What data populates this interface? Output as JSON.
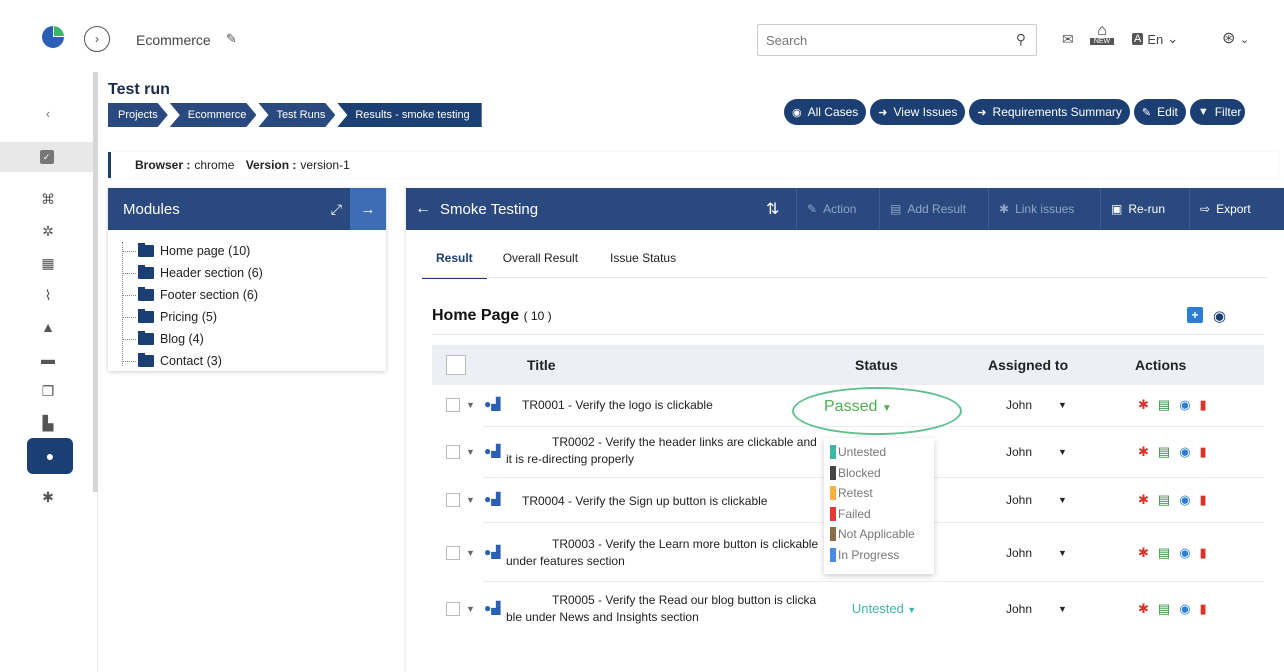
{
  "header": {
    "project_name": "Ecommerce",
    "search_placeholder": "Search",
    "new_badge": "NEW",
    "language": "En",
    "translate_glyph": "A"
  },
  "page": {
    "title": "Test run",
    "breadcrumb": [
      "Projects",
      "Ecommerce",
      "Test Runs",
      "Results - smoke testing"
    ]
  },
  "toolbar": {
    "all_cases": "All Cases",
    "view_issues": "View Issues",
    "requirements_summary": "Requirements Summary",
    "edit": "Edit",
    "filter": "Filter"
  },
  "browser_info": {
    "browser_label": "Browser :",
    "browser_value": "chrome",
    "version_label": "Version :",
    "version_value": "version-1"
  },
  "modules": {
    "title": "Modules",
    "items": [
      {
        "name": "Home page",
        "count": "(10)"
      },
      {
        "name": "Header section",
        "count": "(6)"
      },
      {
        "name": "Footer section",
        "count": "(6)"
      },
      {
        "name": "Pricing",
        "count": "(5)"
      },
      {
        "name": "Blog",
        "count": "(4)"
      },
      {
        "name": "Contact",
        "count": "(3)"
      }
    ]
  },
  "main": {
    "title": "Smoke Testing",
    "buttons": {
      "action": "Action",
      "add_result": "Add Result",
      "link_issues": "Link issues",
      "rerun": "Re-run",
      "export": "Export"
    },
    "tabs": [
      "Result",
      "Overall Result",
      "Issue Status"
    ],
    "section_title": "Home Page",
    "section_count": "( 10 )",
    "columns": {
      "title": "Title",
      "status": "Status",
      "assigned": "Assigned to",
      "actions": "Actions"
    },
    "rows": [
      {
        "title": "TR0001 - Verify the logo is clickable",
        "status": "Passed",
        "assignee": "John"
      },
      {
        "title_l1": "TR0002 - Verify the header links are clickable and",
        "title_l2": "it is re-directing properly",
        "assignee": "John"
      },
      {
        "title": "TR0004 - Verify the Sign up button is clickable",
        "assignee": "John"
      },
      {
        "title_l1": "TR0003 - Verify the Learn more button is clickable",
        "title_l2": "under features section",
        "assignee": "John"
      },
      {
        "title_l1": "TR0005 - Verify the Read our blog button is clicka",
        "title_l2": "ble under News and Insights section",
        "status": "Untested",
        "assignee": "John"
      }
    ],
    "status_options": [
      {
        "label": "Untested",
        "color": "#3fb6a8"
      },
      {
        "label": "Blocked",
        "color": "#444444"
      },
      {
        "label": "Retest",
        "color": "#f5b041"
      },
      {
        "label": "Failed",
        "color": "#e53935"
      },
      {
        "label": "Not Applicable",
        "color": "#8b6d4a"
      },
      {
        "label": "In Progress",
        "color": "#4a8be0"
      }
    ]
  },
  "colors": {
    "primary": "#1b3f73",
    "header_blue": "#2a4a7f",
    "passed_green": "#4caf50"
  }
}
